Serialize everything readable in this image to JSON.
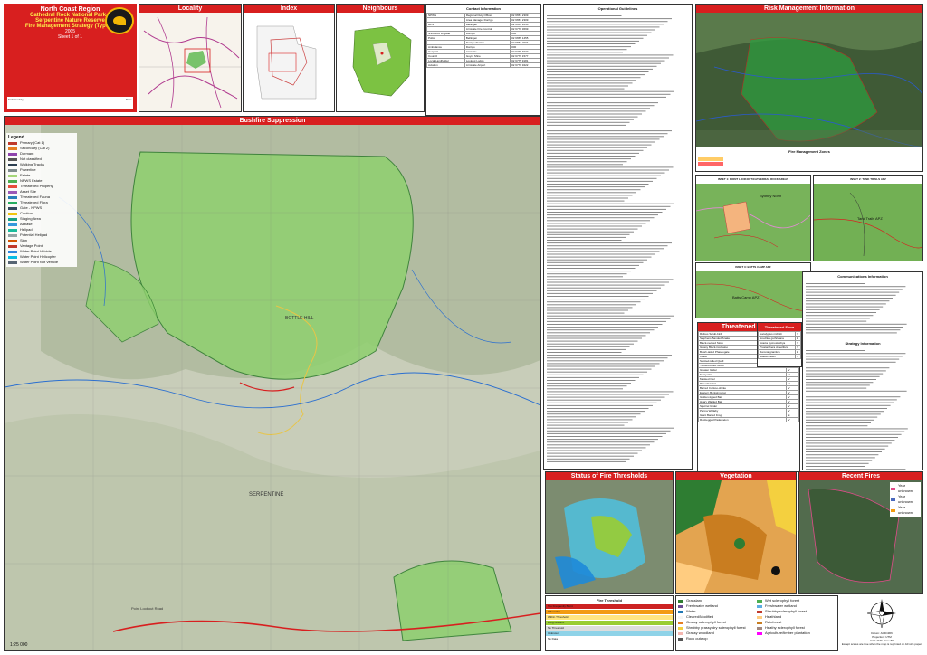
{
  "title_block": {
    "region": "North Coast Region",
    "park_line1": "Cathedral Rock National Park –",
    "park_line2": "Serpentine Nature Reserve",
    "strategy": "Fire Management Strategy (Type 2)",
    "year": "2005",
    "sheet": "Sheet 1 of 1"
  },
  "headers": {
    "locality": "Locality",
    "index": "Index",
    "neighbours": "Neighbours",
    "contact_info": "Contact Information",
    "operational_guidelines": "Operational Guidelines",
    "risk_management": "Risk Management Information",
    "bushfire_suppression": "Bushfire Suppression",
    "threatened_fauna": "Threatened Fauna",
    "threatened_flora": "Threatened Flora",
    "fire_thresholds": "Status of Fire Thresholds",
    "vegetation": "Vegetation",
    "recent_fires": "Recent Fires",
    "fire_threshold_table": "Fire Threshold",
    "communications_info": "Communications Information",
    "strategy_information": "Strategy Information",
    "map_of_zones": "Fire Management Zones"
  },
  "insets": {
    "inset1": "INSET 1: POINT LOOKOUT/CATHEDRAL ROCK AREAS",
    "inset2": "INSET 2: TANK TRAILS APZ",
    "inset3": "INSET 3: BATTS CAMP APZ"
  },
  "labels": {
    "road_label": "Point Lookout Road",
    "map_place_hill": "BOTTLE HILL",
    "map_place_serpentine": "SERPENTINE",
    "scale": "1:25 000",
    "sydney_north": "Sydney North",
    "tank_trails": "Tank Trails APZ",
    "batts_camp": "Batts Camp APZ"
  },
  "legend_title": "Legend",
  "legend_items": [
    {
      "label": "Primary (Cat 1)",
      "color": "#c0392b"
    },
    {
      "label": "Secondary (Cat 2)",
      "color": "#e67e22"
    },
    {
      "label": "Dormant",
      "color": "#8e44ad"
    },
    {
      "label": "Not classified",
      "color": "#555555"
    },
    {
      "label": "Walking Tracks",
      "color": "#2c3e50"
    },
    {
      "label": "Powerline",
      "color": "#7f8c8d"
    },
    {
      "label": "Estate",
      "color": "#a5d67a"
    },
    {
      "label": "NPWS Estate",
      "color": "#4caf50"
    },
    {
      "label": "Threatened Property",
      "color": "#e74c3c"
    },
    {
      "label": "Asset Site",
      "color": "#9b59b6"
    },
    {
      "label": "Threatened Fauna",
      "color": "#2980b9"
    },
    {
      "label": "Threatened Flora",
      "color": "#27ae60"
    },
    {
      "label": "Gate - NPWS",
      "color": "#34495e"
    },
    {
      "label": "Caution",
      "color": "#f1c40f"
    },
    {
      "label": "Staging Area",
      "color": "#16a085"
    },
    {
      "label": "Airbase",
      "color": "#3498db"
    },
    {
      "label": "Helipad",
      "color": "#1abc9c"
    },
    {
      "label": "Potential Helipad",
      "color": "#95a5a6"
    },
    {
      "label": "Sign",
      "color": "#d35400"
    },
    {
      "label": "Vantage Point",
      "color": "#c0392b"
    },
    {
      "label": "Water Point Vehicle",
      "color": "#2e86de"
    },
    {
      "label": "Water Point Helicopter",
      "color": "#0abde3"
    },
    {
      "label": "Water Point Not Vehicle",
      "color": "#576574"
    }
  ],
  "contact_rows": [
    [
      "NPWS",
      "Regional Duty Officer",
      "02 6657 2309"
    ],
    [
      "",
      "Area Manager Dorrigo",
      "02 6657 2309"
    ],
    [
      "RFS",
      "Bellingen",
      "02 6655 1050"
    ],
    [
      "",
      "Armidale Fire Control",
      "02 6770 3699"
    ],
    [
      "NSW Fire Brigade",
      "Dorrigo",
      "000"
    ],
    [
      "Police",
      "Bellingen",
      "02 6655 1455"
    ],
    [
      "",
      "Dorrigo Station",
      "02 6657 2004"
    ],
    [
      "Ambulance",
      "Dorrigo",
      "000"
    ],
    [
      "Hospital",
      "Armidale",
      "02 6776 4933"
    ],
    [
      "Council",
      "Guyra Shire",
      "02 6779 1577"
    ],
    [
      "Local Landholder",
      "Lookout Lodge",
      "02 6775 9181"
    ],
    [
      "Aviation",
      "Armidale Airport",
      "02 6770 3222"
    ]
  ],
  "fauna_rows": [
    [
      "Rufous Scrub-bird",
      "V"
    ],
    [
      "Stephens Banded Snake",
      "V"
    ],
    [
      "Black-necked Stork",
      "E"
    ],
    [
      "Glossy Black-Cockatoo",
      "V"
    ],
    [
      "Brush-tailed Phascogale",
      "V"
    ],
    [
      "Koala",
      "V"
    ],
    [
      "Spotted-tailed Quoll",
      "V"
    ],
    [
      "Yellow-bellied Glider",
      "V"
    ],
    [
      "Greater Glider",
      "V"
    ],
    [
      "Sooty Owl",
      "V"
    ],
    [
      "Masked Owl",
      "V"
    ],
    [
      "Powerful Owl",
      "V"
    ],
    [
      "Barred Cuckoo-shrike",
      "V"
    ],
    [
      "Eastern Bentwing-bat",
      "V"
    ],
    [
      "Golden-tipped Bat",
      "V"
    ],
    [
      "Hoary Wattled Bat",
      "V"
    ],
    [
      "Squirrel Glider",
      "V"
    ],
    [
      "Parma Wallaby",
      "V"
    ],
    [
      "Giant Barred Frog",
      "E"
    ],
    [
      "Red-legged Pademelon",
      "V"
    ]
  ],
  "flora_rows": [
    [
      "Eucalyptus nicholii",
      "V"
    ],
    [
      "Grevillea guthrieana",
      "E"
    ],
    [
      "Acacia pycnostachya",
      "V"
    ],
    [
      "Prostanthera cineolifera",
      "V"
    ],
    [
      "Boronia granitica",
      "E"
    ],
    [
      "Hakea fraseri",
      "V"
    ]
  ],
  "threshold_rows": [
    {
      "label": "Too Frequently Burnt",
      "color": "#cc2222"
    },
    {
      "label": "Vulnerable",
      "color": "#f39c12"
    },
    {
      "label": "Within Threshold",
      "color": "#ffe680"
    },
    {
      "label": "Long Unburnt",
      "color": "#9acd32"
    },
    {
      "label": "No Threshold",
      "color": "#dddddd"
    },
    {
      "label": "Unknown",
      "color": "#8fd3e8"
    },
    {
      "label": "No Data",
      "color": "#ffffff"
    }
  ],
  "veg_legend": [
    {
      "label": "Grassland",
      "color": "#2e7d32"
    },
    {
      "label": "Wet sclerophyll forest",
      "color": "#4caf50"
    },
    {
      "label": "Freshwater wetland",
      "color": "#6a4c93"
    },
    {
      "label": "Freshwater wetland",
      "color": "#5dade2"
    },
    {
      "label": "Water",
      "color": "#1f77b4"
    },
    {
      "label": "Shrubby sclerophyll forest",
      "color": "#c0392b"
    },
    {
      "label": "Cleared/Modified",
      "color": "#f5f5f5"
    },
    {
      "label": "Heathland",
      "color": "#ffcc80"
    },
    {
      "label": "Grassy sclerophyll forest",
      "color": "#e67e22"
    },
    {
      "label": "Rainforest",
      "color": "#c97d20"
    },
    {
      "label": "Shrubby grassy dry sclerophyll forest",
      "color": "#f4d03f"
    },
    {
      "label": "Heathy sclerophyll forest",
      "color": "#a1887f"
    },
    {
      "label": "Grassy woodland",
      "color": "#f5b7b1"
    },
    {
      "label": "Agriculture/timber plantation",
      "color": "#ff00ff"
    },
    {
      "label": "Rock outcrop",
      "color": "#555555"
    }
  ],
  "recent_fires_legend": [
    "Year unknown",
    "Year unknown",
    "Year unknown"
  ],
  "footer": {
    "datum": "Datum: AGD1966",
    "projection": "Projection: UTM",
    "grid": "Grid: AMG Zone 56",
    "note": "Except scales are true when the map is reprinted on A0 size paper"
  },
  "north_label": "N",
  "endorsed_label": "Endorsed by:",
  "date_label": "Date:"
}
